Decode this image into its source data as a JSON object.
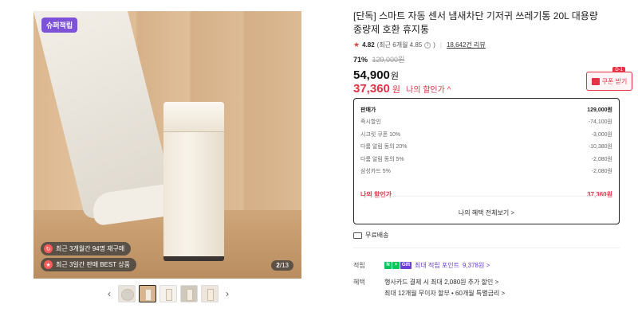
{
  "gallery": {
    "badge": "슈퍼적립",
    "pills": [
      {
        "text": "최근 3개월간 94명 재구매"
      },
      {
        "text": "최근 3일간 판매 BEST 상품"
      }
    ],
    "counter_current": "2",
    "counter_total": "/13",
    "prev_arrow": "‹",
    "next_arrow": "›"
  },
  "product": {
    "title": "[단독] 스마트 자동 센서 냄새차단 기저귀 쓰레기통 20L 대용량 종량제 호환 휴지통",
    "rating_score": "4.82",
    "rating_detail": "(최근 6개월 4.85",
    "rating_close": ")",
    "reviews": "18,642건 리뷰",
    "discount_pct": "71%",
    "original_price": "129,000원",
    "price": "54,900",
    "price_unit": "원",
    "sale_price": "37,360",
    "sale_unit": "원",
    "my_discount_label": "나의 할인가 ^",
    "coupon_tag": "D-1",
    "coupon_label": "쿠폰 받기"
  },
  "breakdown": {
    "rows": [
      {
        "label": "판매가",
        "value": "129,000원"
      },
      {
        "label": "즉시할인",
        "value": "-74,100원"
      },
      {
        "label": "시크릿 쿠폰 10%",
        "value": "-3,000원"
      },
      {
        "label": "다룸 알림 동의 20%",
        "value": "-10,380원"
      },
      {
        "label": "다룸 알림 동의 5%",
        "value": "-2,080원"
      },
      {
        "label": "삼성카드 5%",
        "value": "-2,080원"
      }
    ],
    "total_label": "나의 할인가",
    "total_value": "37,360원",
    "footer": "나의 혜택 전체보기 >"
  },
  "shipping": {
    "label": "무료배송"
  },
  "points": {
    "label": "적립",
    "logo": [
      "N",
      "+",
      "Gift"
    ],
    "text": "최대 적립 포인트",
    "amount": "9,378원 >"
  },
  "benefits": {
    "label": "혜택",
    "lines": [
      "행사카드 결제 시 최대 2,080원 추가 할인 >",
      "최대 12개월 무이자 할부 • 60개월 특별금리 >"
    ]
  },
  "colors": {
    "accent": "#e53244",
    "badge": "#7d52d8",
    "point": "#6b3fd4"
  }
}
